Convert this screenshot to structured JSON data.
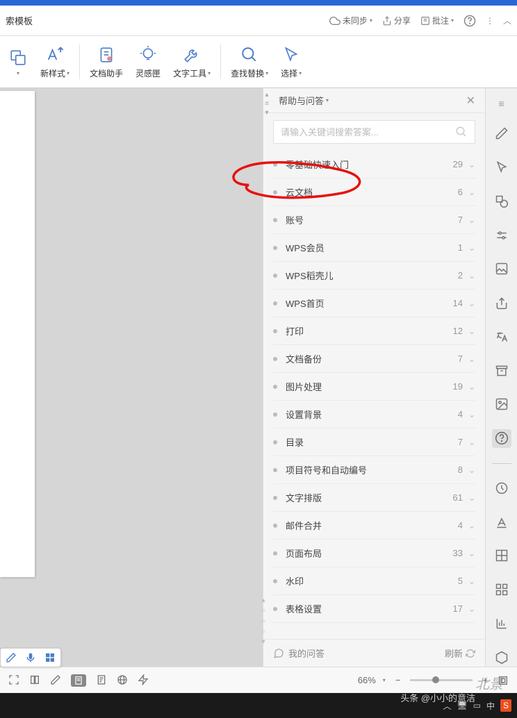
{
  "topbar": {
    "left_label": "索模板",
    "sync": "未同步",
    "share": "分享",
    "annotate": "批注"
  },
  "toolbar": {
    "new_style": "新样式",
    "doc_helper": "文档助手",
    "inspiration": "灵感匣",
    "text_tools": "文字工具",
    "find_replace": "查找替换",
    "select": "选择"
  },
  "panel": {
    "title": "帮助与问答",
    "search_placeholder": "请输入关键词搜索答案...",
    "my_qa": "我的问答",
    "refresh": "刷新"
  },
  "help_items": [
    {
      "label": "零基础快速入门",
      "count": 29
    },
    {
      "label": "云文档",
      "count": 6
    },
    {
      "label": "账号",
      "count": 7
    },
    {
      "label": "WPS会员",
      "count": 1
    },
    {
      "label": "WPS稻壳儿",
      "count": 2
    },
    {
      "label": "WPS首页",
      "count": 14
    },
    {
      "label": "打印",
      "count": 12
    },
    {
      "label": "文档备份",
      "count": 7
    },
    {
      "label": "图片处理",
      "count": 19
    },
    {
      "label": "设置背景",
      "count": 4
    },
    {
      "label": "目录",
      "count": 7
    },
    {
      "label": "项目符号和自动编号",
      "count": 8
    },
    {
      "label": "文字排版",
      "count": 61
    },
    {
      "label": "邮件合并",
      "count": 4
    },
    {
      "label": "页面布局",
      "count": 33
    },
    {
      "label": "水印",
      "count": 5
    },
    {
      "label": "表格设置",
      "count": 17
    }
  ],
  "status": {
    "zoom": "66%"
  },
  "taskbar": {
    "ime_lang": "中",
    "author": "头条 @小小的意洁"
  }
}
